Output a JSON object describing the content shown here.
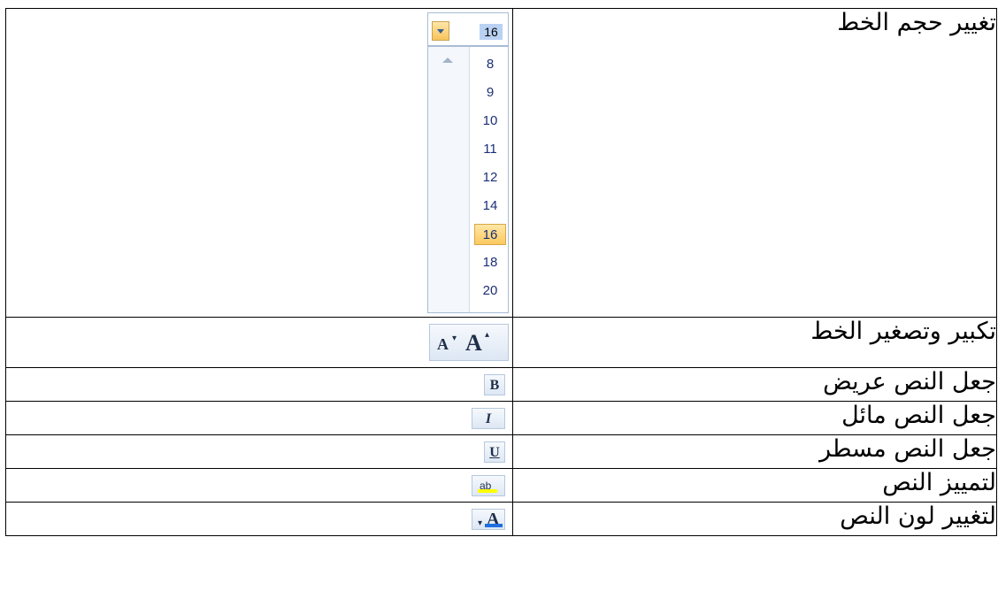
{
  "rows": [
    {
      "label": "تغيير حجم الخط"
    },
    {
      "label": "تكبير وتصغير الخط"
    },
    {
      "label": "جعل النص عريض"
    },
    {
      "label": "جعل النص مائل"
    },
    {
      "label": "جعل النص مسطر"
    },
    {
      "label": "لتمييز النص"
    },
    {
      "label": "لتغيير لون النص"
    }
  ],
  "font_size": {
    "current": "16",
    "options": [
      "8",
      "9",
      "10",
      "11",
      "12",
      "14",
      "16",
      "18",
      "20"
    ],
    "selected": "16"
  },
  "buttons": {
    "grow_big": "A",
    "grow_small": "A",
    "bold": "B",
    "italic": "I",
    "underline": "U",
    "highlight": "ab",
    "color": "A"
  }
}
